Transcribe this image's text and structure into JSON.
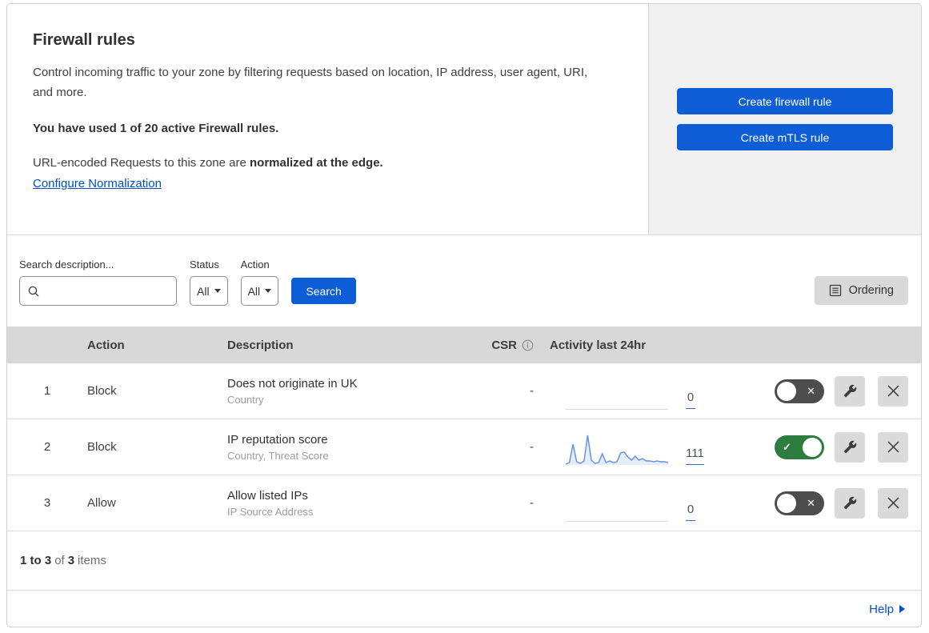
{
  "header": {
    "title": "Firewall rules",
    "description": "Control incoming traffic to your zone by filtering requests based on location, IP address, user agent, URI, and more.",
    "usage": "You have used 1 of 20 active Firewall rules.",
    "normalization_prefix": "URL-encoded Requests to this zone are ",
    "normalization_bold": "normalized at the edge.",
    "link_label": "Configure Normalization",
    "buttons": [
      "Create firewall rule",
      "Create mTLS rule"
    ]
  },
  "filters": {
    "search_label": "Search description...",
    "status_label": "Status",
    "status_value": "All",
    "action_label": "Action",
    "action_value": "All",
    "search_button": "Search",
    "ordering_button": "Ordering"
  },
  "table": {
    "columns": {
      "action": "Action",
      "description": "Description",
      "csr": "CSR",
      "activity": "Activity last 24hr"
    },
    "rows": [
      {
        "priority": "1",
        "action": "Block",
        "description": "Does not originate in UK",
        "fields": "Country",
        "csr": "-",
        "activity_count": "0",
        "enabled": false,
        "sparkline": []
      },
      {
        "priority": "2",
        "action": "Block",
        "description": "IP reputation score",
        "fields": "Country, Threat Score",
        "csr": "-",
        "activity_count": "111",
        "enabled": true,
        "sparkline": [
          38,
          36,
          13,
          35,
          37,
          34,
          2,
          33,
          37,
          36,
          25,
          36,
          34,
          36,
          35,
          24,
          23,
          29,
          33,
          28,
          33,
          31,
          34,
          34,
          35,
          34,
          35,
          35,
          36
        ]
      },
      {
        "priority": "3",
        "action": "Allow",
        "description": "Allow listed IPs",
        "fields": "IP Source Address",
        "csr": "-",
        "activity_count": "0",
        "enabled": false,
        "sparkline": []
      }
    ]
  },
  "footer": {
    "pagination": {
      "range": "1 to 3",
      "of": "of",
      "total": "3",
      "items": "items"
    },
    "help": "Help"
  },
  "colors": {
    "primary_blue": "#0d5dd6",
    "link_blue": "#0051c3",
    "toggle_on_green": "#2e7d3e",
    "toggle_off_gray": "#4d4d4d",
    "sparkline_blue": "#5d8de4",
    "table_header_gray": "#d8d8d8",
    "panel_gray": "#f1f1f1"
  }
}
